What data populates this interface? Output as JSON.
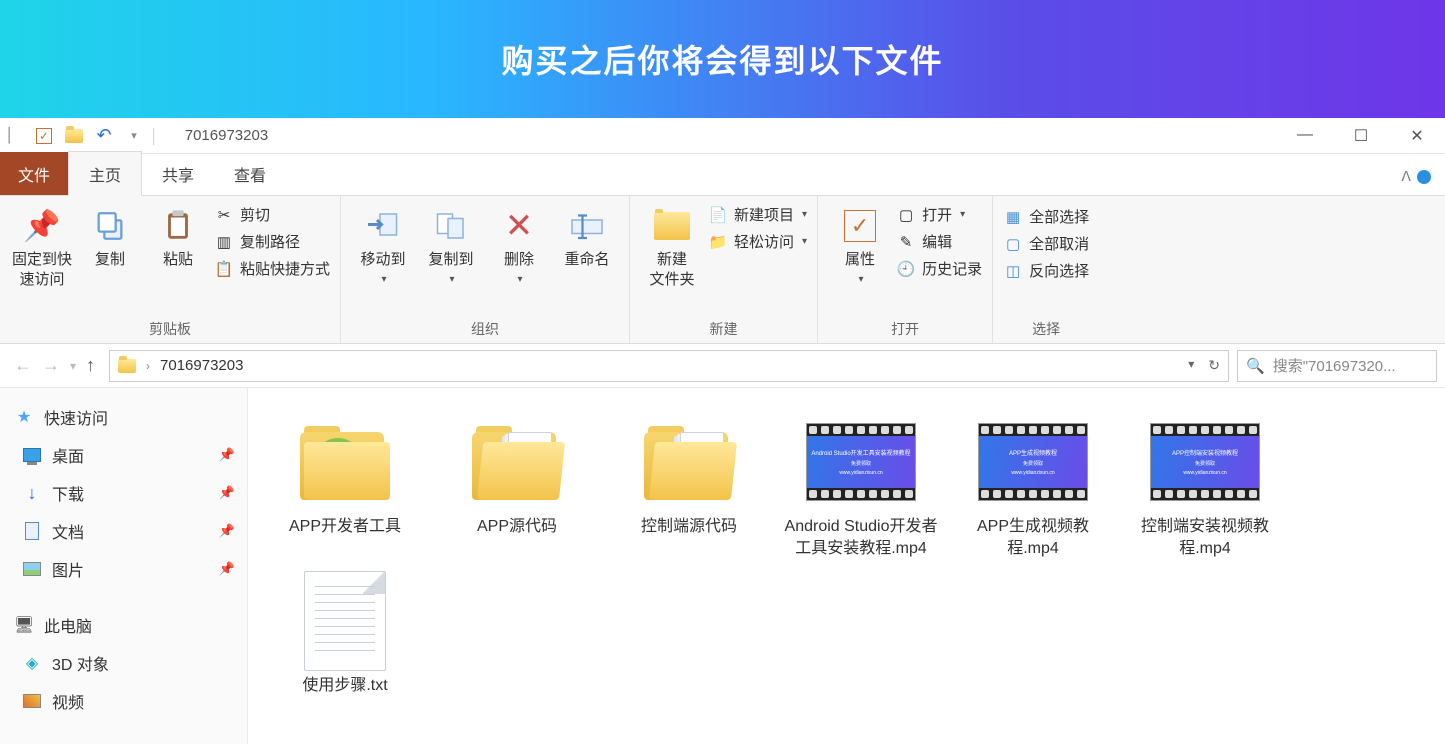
{
  "banner": {
    "text": "购买之后你将会得到以下文件"
  },
  "titlebar": {
    "title": "7016973203"
  },
  "tabs": {
    "file": "文件",
    "home": "主页",
    "share": "共享",
    "view": "查看"
  },
  "ribbon": {
    "clipboard": {
      "label": "剪贴板",
      "pin": "固定到快\n速访问",
      "copy": "复制",
      "paste": "粘贴",
      "cut": "剪切",
      "copy_path": "复制路径",
      "paste_shortcut": "粘贴快捷方式"
    },
    "organize": {
      "label": "组织",
      "move_to": "移动到",
      "copy_to": "复制到",
      "delete": "删除",
      "rename": "重命名"
    },
    "new": {
      "label": "新建",
      "new_folder": "新建\n文件夹",
      "new_item": "新建项目",
      "easy_access": "轻松访问"
    },
    "open": {
      "label": "打开",
      "properties": "属性",
      "open": "打开",
      "edit": "编辑",
      "history": "历史记录"
    },
    "select": {
      "label": "选择",
      "select_all": "全部选择",
      "select_none": "全部取消",
      "invert": "反向选择"
    }
  },
  "addressbar": {
    "crumb": "7016973203"
  },
  "search": {
    "placeholder": "搜索\"701697320..."
  },
  "sidebar": {
    "quick_access": "快速访问",
    "desktop": "桌面",
    "downloads": "下载",
    "documents": "文档",
    "pictures": "图片",
    "this_pc": "此电脑",
    "objects_3d": "3D 对象",
    "videos": "视频"
  },
  "files": [
    {
      "name": "APP开发者工具",
      "type": "folder_app"
    },
    {
      "name": "APP源代码",
      "type": "folder_docs"
    },
    {
      "name": "控制端源代码",
      "type": "folder_docs"
    },
    {
      "name": "Android Studio开发者工具安装教程.mp4",
      "type": "video",
      "caption": "Android Studio开发工具安装视频教程"
    },
    {
      "name": "APP生成视频教程.mp4",
      "type": "video",
      "caption": "APP生成视频教程"
    },
    {
      "name": "控制端安装视频教程.mp4",
      "type": "video",
      "caption": "APP控制端安装视频教程"
    },
    {
      "name": "使用步骤.txt",
      "type": "txt"
    }
  ]
}
